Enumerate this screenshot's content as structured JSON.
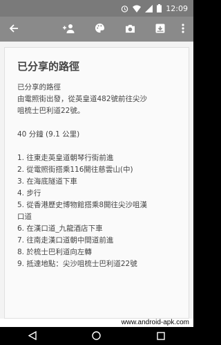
{
  "status_bar": {
    "time": "12:09"
  },
  "icons": {
    "back": "arrow-back-icon",
    "collaborator": "person-add-icon",
    "palette": "palette-icon",
    "camera": "camera-icon",
    "archive": "archive-icon",
    "more": "more-vert-icon"
  },
  "note": {
    "title": "已分享的路徑",
    "lines": [
      "已分享的路徑",
      "由電照街出發，從英皇道482號前往尖沙",
      "咀梳士巴利道22號。",
      "",
      "40 分鐘 (9.1 公里)",
      "",
      "1. 往東走英皇道朝琴行街前進",
      "2. 從電照街搭乘116開往慈雲山(中)",
      "3. 在海底隧道下車",
      "4. 步行",
      "5. 從香港歷史博物館搭乘8開往尖沙咀漢",
      "口道",
      "6. 在漢口道_九龍酒店下車",
      "7. 往南走漢口道朝中間道前進",
      "8. 於梳士巴利道向左轉",
      "9. 抵達地點：尖沙咀梳士巴利道22號"
    ]
  },
  "watermark": "www.android-apk.com",
  "colors": {
    "toolbar": "#8a8a8a",
    "status_bar": "#7a7a7a",
    "note_bg": "#fafafa"
  }
}
